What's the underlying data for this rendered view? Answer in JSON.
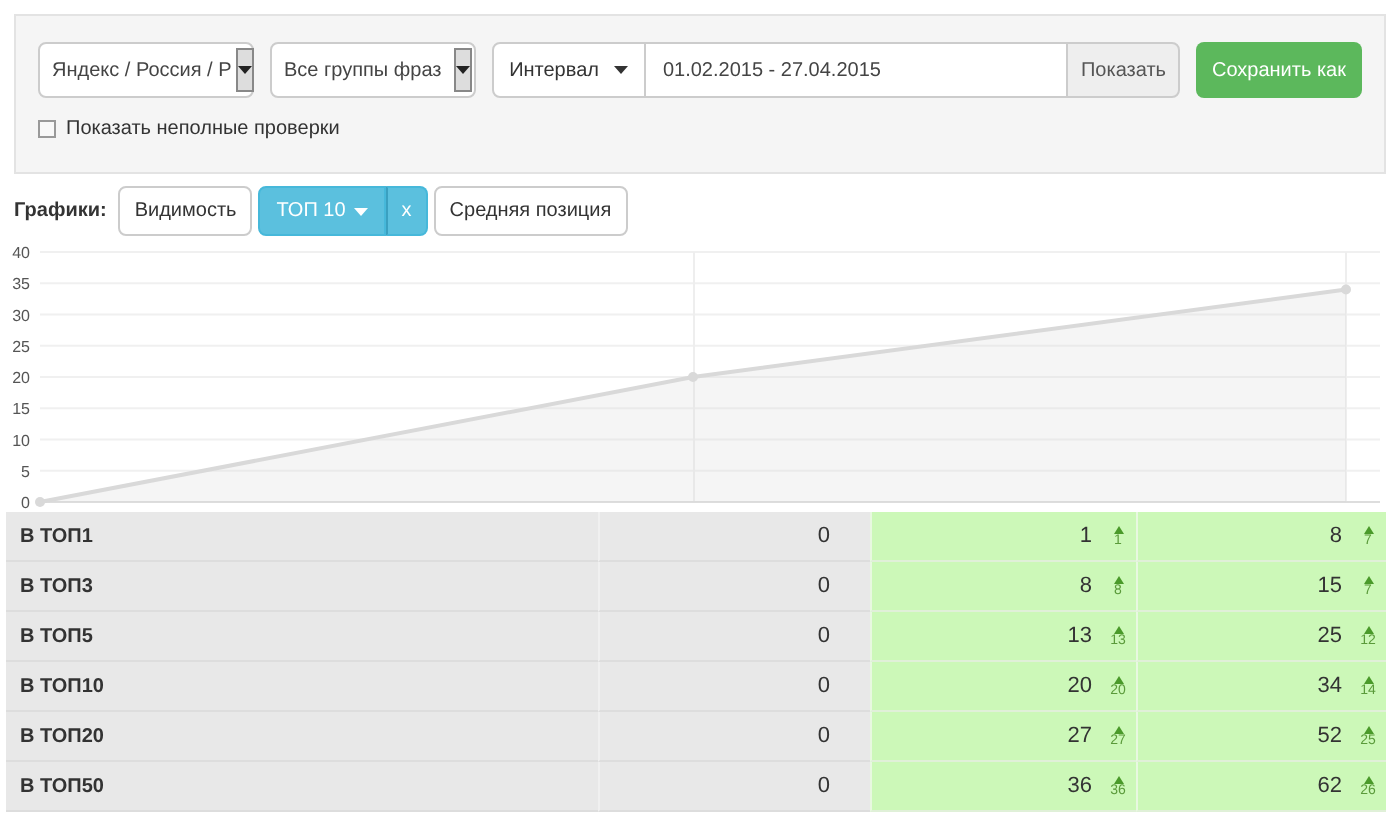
{
  "filters": {
    "engine_select": "Яндекс / Россия / Р",
    "group_select": "Все группы фраз",
    "interval_button": "Интервал",
    "date_range": "01.02.2015 - 27.04.2015",
    "show_button": "Показать",
    "save_button": "Сохранить как",
    "incomplete_checkbox": {
      "label": "Показать неполные проверки",
      "checked": false
    }
  },
  "charts_bar": {
    "label": "Графики:",
    "buttons": [
      {
        "label": "Видимость",
        "selected": false,
        "kind": "plain"
      },
      {
        "label": "ТОП 10",
        "selected": true,
        "kind": "dropdown",
        "remove": "x"
      },
      {
        "label": "Средняя позиция",
        "selected": false,
        "kind": "plain"
      }
    ]
  },
  "chart": {
    "chart_data": {
      "type": "area",
      "grid": true,
      "ylim": [
        0,
        40
      ],
      "yticks": [
        0,
        5,
        10,
        15,
        20,
        25,
        30,
        35,
        40
      ],
      "series": [
        {
          "color": "#d9d9d9",
          "values": [
            0,
            20,
            34
          ]
        }
      ]
    }
  },
  "table": {
    "rows": [
      {
        "label": "В ТОП1",
        "column_2": "0",
        "column_3": {
          "value": "1",
          "up": true,
          "delta": "1"
        },
        "column_4": {
          "value": "8",
          "up": true,
          "delta": "7"
        }
      },
      {
        "label": "В ТОП3",
        "column_2": "0",
        "column_3": {
          "value": "8",
          "up": true,
          "delta": "8"
        },
        "column_4": {
          "value": "15",
          "up": true,
          "delta": "7"
        }
      },
      {
        "label": "В ТОП5",
        "column_2": "0",
        "column_3": {
          "value": "13",
          "up": true,
          "delta": "13"
        },
        "column_4": {
          "value": "25",
          "up": true,
          "delta": "12"
        }
      },
      {
        "label": "В ТОП10",
        "column_2": "0",
        "column_3": {
          "value": "20",
          "up": true,
          "delta": "20"
        },
        "column_4": {
          "value": "34",
          "up": true,
          "delta": "14"
        }
      },
      {
        "label": "В ТОП20",
        "column_2": "0",
        "column_3": {
          "value": "27",
          "up": true,
          "delta": "27"
        },
        "column_4": {
          "value": "52",
          "up": true,
          "delta": "25"
        }
      },
      {
        "label": "В ТОП50",
        "column_2": "0",
        "column_3": {
          "value": "36",
          "up": true,
          "delta": "36"
        },
        "column_4": {
          "value": "62",
          "up": true,
          "delta": "26"
        }
      }
    ]
  }
}
